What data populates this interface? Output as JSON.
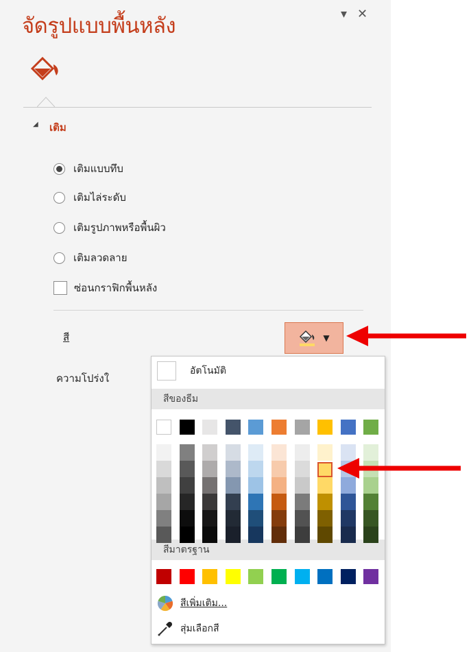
{
  "pane": {
    "title": "จัดรูปแบบพื้นหลัง",
    "options_icon": "chevron-down-icon",
    "close_icon": "close-icon",
    "category_icon": "paint-bucket-icon"
  },
  "fill_section": {
    "label": "เติม",
    "options": [
      {
        "label": "เติมแบบทึบ",
        "selected": true
      },
      {
        "label": "เติมไล่ระดับ",
        "selected": false
      },
      {
        "label": "เติมรูปภาพหรือพื้นผิว",
        "selected": false
      },
      {
        "label": "เติมลวดลาย",
        "selected": false
      }
    ],
    "hide_background_graphics": {
      "label": "ซ่อนกราฟิกพื้นหลัง",
      "checked": false
    },
    "color_label": "สี",
    "transparency_label": "ความโปร่งใ"
  },
  "color_picker": {
    "automatic": "อัตโนมัติ",
    "theme_colors_header": "สีของธีม",
    "theme_colors": [
      {
        "top": "#ffffff",
        "tints": [
          "#f2f2f2",
          "#d9d9d9",
          "#bfbfbf",
          "#a6a6a6",
          "#808080",
          "#595959"
        ]
      },
      {
        "top": "#000000",
        "tints": [
          "#808080",
          "#595959",
          "#404040",
          "#262626",
          "#0d0d0d",
          "#000000"
        ]
      },
      {
        "top": "#e7e6e6",
        "tints": [
          "#d0cece",
          "#aeabab",
          "#757171",
          "#3a3838",
          "#171616",
          "#0b0b0b"
        ]
      },
      {
        "top": "#44546a",
        "tints": [
          "#d6dce4",
          "#adb9ca",
          "#8497b0",
          "#333f50",
          "#222a35",
          "#1a202b"
        ]
      },
      {
        "top": "#5b9bd5",
        "tints": [
          "#deebf6",
          "#bdd7ee",
          "#9dc3e6",
          "#2e75b5",
          "#1f4e79",
          "#17375e"
        ]
      },
      {
        "top": "#ed7d31",
        "tints": [
          "#fbe5d5",
          "#f7cbac",
          "#f4b183",
          "#c55a11",
          "#843c0c",
          "#622d09"
        ]
      },
      {
        "top": "#a5a5a5",
        "tints": [
          "#ededed",
          "#dbdbdb",
          "#c9c9c9",
          "#7b7b7b",
          "#525252",
          "#3d3d3d"
        ]
      },
      {
        "top": "#ffc000",
        "tints": [
          "#fff2cc",
          "#ffe699",
          "#ffd966",
          "#bf9000",
          "#7f6000",
          "#5f4800"
        ]
      },
      {
        "top": "#4472c4",
        "tints": [
          "#dae3f3",
          "#b4c7e7",
          "#8faadc",
          "#2f5597",
          "#203864",
          "#192b4d"
        ]
      },
      {
        "top": "#70ad47",
        "tints": [
          "#e2f0d9",
          "#c5e0b4",
          "#a9d18e",
          "#538135",
          "#375623",
          "#2a421b"
        ]
      }
    ],
    "selected": {
      "column": 7,
      "tint": 1
    },
    "standard_colors_header": "สีมาตรฐาน",
    "standard_colors": [
      "#c00000",
      "#ff0000",
      "#ffc000",
      "#ffff00",
      "#92d050",
      "#00b050",
      "#00b0f0",
      "#0070c0",
      "#002060",
      "#7030a0"
    ],
    "more_colors": "สีเพิ่มเติม...",
    "more_colors_icon": "color-wheel-icon",
    "eyedropper": "สุ่มเลือกสี",
    "eyedropper_icon": "eyedropper-icon"
  },
  "annotations": {
    "arrow_color": "#ee0000",
    "arrow_icon": "red-arrow-icon"
  }
}
